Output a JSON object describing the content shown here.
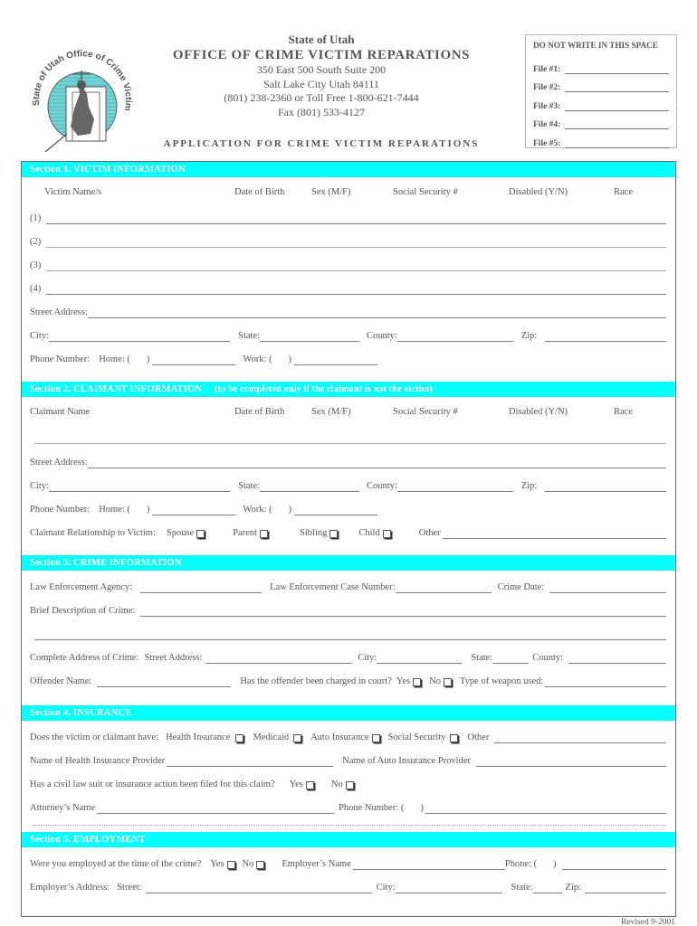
{
  "header": {
    "logo_text": "State of Utah Office of Crime Victim Reparations",
    "state": "State of Utah",
    "office": "OFFICE OF CRIME VICTIM REPARATIONS",
    "address1": "350 East 500 South Suite 200",
    "address2": "Salt Lake City Utah 84111",
    "phone": "(801) 238-2360 or Toll Free 1-800-621-7444",
    "fax": "Fax (801) 533-4127",
    "application_title": "APPLICATION FOR CRIME VICTIM REPARATIONS"
  },
  "office_use": {
    "title": "DO NOT WRITE IN THIS SPACE",
    "files": [
      "File #1:",
      "File #2:",
      "File #3:",
      "File #4:",
      "File #5:"
    ]
  },
  "section1": {
    "title": "Section 1. VICTIM INFORMATION",
    "columns": [
      "Victim Name/s",
      "Date of Birth",
      "Sex (M/F)",
      "Social Security #",
      "Disabled (Y/N)",
      "Race"
    ],
    "rows": [
      "(1)",
      "(2)",
      "(3)",
      "(4)"
    ],
    "street": "Street  Address:",
    "city": "City:",
    "state": "State:",
    "county": "County:",
    "zip": "Zip:",
    "phone": "Phone Number:",
    "home": "Home: (",
    "paren_close": ")",
    "work": "Work: ("
  },
  "section2": {
    "title": "Section 2. CLAIMANT  INFORMATION",
    "subtitle": "(to be completed only if the claimant is not the victim)",
    "columns": [
      "Claimant Name",
      "Date of Birth",
      "Sex (M/F)",
      "Social Security #",
      "Disabled (Y/N)",
      "Race"
    ],
    "street": "Street  Address:",
    "city": "City:",
    "state": "State:",
    "county": "County:",
    "zip": "Zip:",
    "phone": "Phone Number:",
    "home": "Home: (",
    "paren_close": ")",
    "work": "Work: (",
    "relationship_label": "Claimant Relationship to Victim:",
    "relationships": [
      "Spouse",
      "Parent",
      "Sibling",
      "Child"
    ],
    "other": "Other"
  },
  "section3": {
    "title": "Section 3.  CRIME INFORMATION",
    "agency": "Law Enforcement Agency:",
    "case_number": "Law Enforcement Case Number:",
    "crime_date": "Crime Date:",
    "description": "Brief Description of Crime:",
    "complete_address": "Complete Address of Crime:",
    "street": "Street  Address:",
    "city": "City:",
    "state": "State:",
    "county": "County:",
    "offender": "Offender Name:",
    "charged": "Has the offender been charged in court?",
    "yes": "Yes",
    "no": "No",
    "weapon": "Type of weapon used:"
  },
  "section4": {
    "title": "Section 4.  INSURANCE",
    "have_label": "Does the victim or claimant have:",
    "options": [
      "Health Insurance",
      "Medicaid",
      "Auto Insurance",
      "Social Security"
    ],
    "other": "Other",
    "health_provider": "Name of Health Insurance Provider",
    "auto_provider": "Name of Auto Insurance Provider",
    "lawsuit": "Has a civil law suit or insurance action been filed for this claim?",
    "yes": "Yes",
    "no": "No",
    "attorney": "Attorney’s Name",
    "phone": "Phone Number: (",
    "paren_close": ")"
  },
  "section5": {
    "title": "Section 5.  EMPLOYMENT",
    "employed": "Were you employed at the time of the crime?",
    "yes": "Yes",
    "no": "No",
    "employer_name": "Employer’s Name",
    "phone": "Phone: (",
    "paren_close": ")",
    "employer_address": "Employer’s Address:",
    "street": "Street:",
    "city": "City:",
    "state": "State:",
    "zip": "Zip:"
  },
  "footer": {
    "revised": "Revised 9-2001"
  },
  "colors": {
    "section_bar": "#05ffff",
    "logo_teal": "#5fc8c8",
    "text": "#555555"
  }
}
